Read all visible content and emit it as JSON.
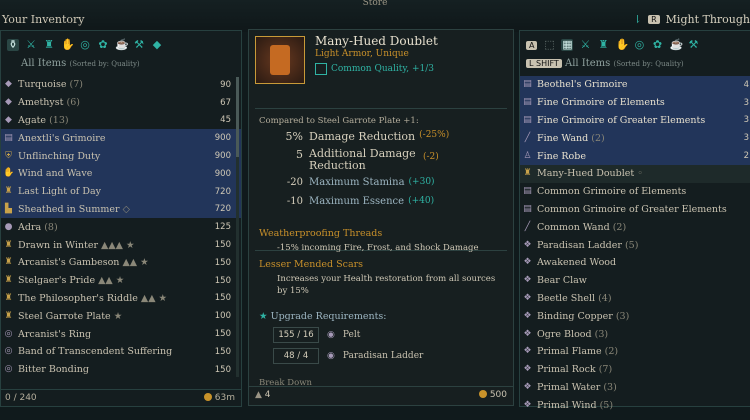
{
  "top": {
    "store_tab": "Store",
    "inventory_title": "Your Inventory",
    "trader_key": "R",
    "trader_name": "Might Through"
  },
  "left": {
    "header": "All Items",
    "sort": "(Sorted by: Quality)",
    "items": [
      {
        "name": "Turquoise",
        "count": "(7)",
        "value": "90",
        "icon": "gem-icon"
      },
      {
        "name": "Amethyst",
        "count": "(6)",
        "value": "67",
        "icon": "gem-icon"
      },
      {
        "name": "Agate",
        "count": "(13)",
        "value": "45",
        "icon": "gem-icon"
      },
      {
        "name": "Anextli's Grimoire",
        "count": "",
        "value": "900",
        "icon": "grimoire-icon",
        "hl": true
      },
      {
        "name": "Unflinching Duty",
        "count": "",
        "value": "900",
        "icon": "shield-icon",
        "hl": true
      },
      {
        "name": "Wind and Wave",
        "count": "",
        "value": "900",
        "icon": "gloves-icon",
        "hl": true
      },
      {
        "name": "Last Light of Day",
        "count": "",
        "value": "720",
        "icon": "armor-icon",
        "hl": true
      },
      {
        "name": "Sheathed in Summer",
        "count": "◇",
        "value": "720",
        "icon": "boots-icon",
        "hl": true
      },
      {
        "name": "Adra",
        "count": "(8)",
        "value": "125",
        "icon": "ore-icon"
      },
      {
        "name": "Drawn in Winter",
        "count": "▲▲▲ ★",
        "value": "150",
        "icon": "armor-icon"
      },
      {
        "name": "Arcanist's Gambeson",
        "count": "▲▲ ★",
        "value": "150",
        "icon": "armor-icon"
      },
      {
        "name": "Stelgaer's Pride",
        "count": "▲▲ ★",
        "value": "150",
        "icon": "armor-icon"
      },
      {
        "name": "The Philosopher's Riddle",
        "count": "▲▲ ★",
        "value": "150",
        "icon": "armor-icon"
      },
      {
        "name": "Steel Garrote Plate",
        "count": "★",
        "value": "100",
        "icon": "armor-icon"
      },
      {
        "name": "Arcanist's Ring",
        "count": "",
        "value": "150",
        "icon": "ring-icon"
      },
      {
        "name": "Band of Transcendent Suffering",
        "count": "",
        "value": "150",
        "icon": "ring-icon"
      },
      {
        "name": "Bitter Bonding",
        "count": "",
        "value": "150",
        "icon": "ring-icon"
      }
    ],
    "capacity": "0 / 240",
    "money": "63m"
  },
  "mid": {
    "name": "Many-Hued Doublet",
    "type": "Light Armor, Unique",
    "quality": "Common Quality, +1/3",
    "compared": "Compared to Steel Garrote Plate +1:",
    "stats": [
      {
        "n": "5%",
        "label": "Damage Reduction",
        "delta": "(-25%)"
      },
      {
        "n": "5",
        "label": "Additional Damage Reduction",
        "delta": "(-2)"
      },
      {
        "n": "-20",
        "label": "Maximum Stamina",
        "delta": "(+30)"
      },
      {
        "n": "-10",
        "label": "Maximum Essence",
        "delta": "(+40)"
      }
    ],
    "ench1_title": "Weatherproofing Threads",
    "ench1_desc": "-15% incoming Fire, Frost, and Shock Damage",
    "ench2_title": "Lesser Mended Scars",
    "ench2_desc": "Increases your Health restoration from all sources by 15%",
    "upgrade_title": "Upgrade Requirements:",
    "req1_amount": "155 / 16",
    "req1_name": "Pelt",
    "req2_amount": "48 / 4",
    "req2_name": "Paradisan Ladder",
    "breakdown": "Break Down",
    "weight": "4",
    "price": "500"
  },
  "right": {
    "key_left": "A",
    "key_shift": "L SHIFT",
    "header": "All Items",
    "sort": "(Sorted by: Quality)",
    "items": [
      {
        "name": "Beothel's Grimoire",
        "count": "",
        "value": "4",
        "icon": "grimoire-icon",
        "hl": true
      },
      {
        "name": "Fine Grimoire of Elements",
        "count": "",
        "value": "3",
        "icon": "grimoire-icon",
        "hl": true
      },
      {
        "name": "Fine Grimoire of Greater Elements",
        "count": "",
        "value": "3",
        "icon": "grimoire-icon",
        "hl": true
      },
      {
        "name": "Fine Wand",
        "count": "(2)",
        "value": "3",
        "icon": "wand-icon",
        "hl": true
      },
      {
        "name": "Fine Robe",
        "count": "",
        "value": "2",
        "icon": "robe-icon",
        "hl": true
      },
      {
        "name": "Many-Hued Doublet",
        "count": "◦",
        "value": "",
        "icon": "armor-icon",
        "sel": true
      },
      {
        "name": "Common Grimoire of Elements",
        "count": "",
        "value": "",
        "icon": "grimoire-icon"
      },
      {
        "name": "Common Grimoire of Greater Elements",
        "count": "",
        "value": "",
        "icon": "grimoire-icon"
      },
      {
        "name": "Common Wand",
        "count": "(2)",
        "value": "",
        "icon": "wand-icon"
      },
      {
        "name": "Paradisan Ladder",
        "count": "(5)",
        "value": "",
        "icon": "material-icon"
      },
      {
        "name": "Awakened Wood",
        "count": "",
        "value": "",
        "icon": "material-icon"
      },
      {
        "name": "Bear Claw",
        "count": "",
        "value": "",
        "icon": "material-icon"
      },
      {
        "name": "Beetle Shell",
        "count": "(4)",
        "value": "",
        "icon": "material-icon"
      },
      {
        "name": "Binding Copper",
        "count": "(3)",
        "value": "",
        "icon": "material-icon"
      },
      {
        "name": "Ogre Blood",
        "count": "(3)",
        "value": "",
        "icon": "material-icon"
      },
      {
        "name": "Primal Flame",
        "count": "(2)",
        "value": "",
        "icon": "material-icon"
      },
      {
        "name": "Primal Rock",
        "count": "(7)",
        "value": "",
        "icon": "material-icon"
      },
      {
        "name": "Primal Water",
        "count": "(3)",
        "value": "",
        "icon": "material-icon"
      },
      {
        "name": "Primal Wind",
        "count": "(5)",
        "value": "",
        "icon": "material-icon"
      }
    ]
  },
  "colors": {
    "teal": "#2fb3a4",
    "gold": "#c8902a",
    "highlight": "#22355a"
  }
}
